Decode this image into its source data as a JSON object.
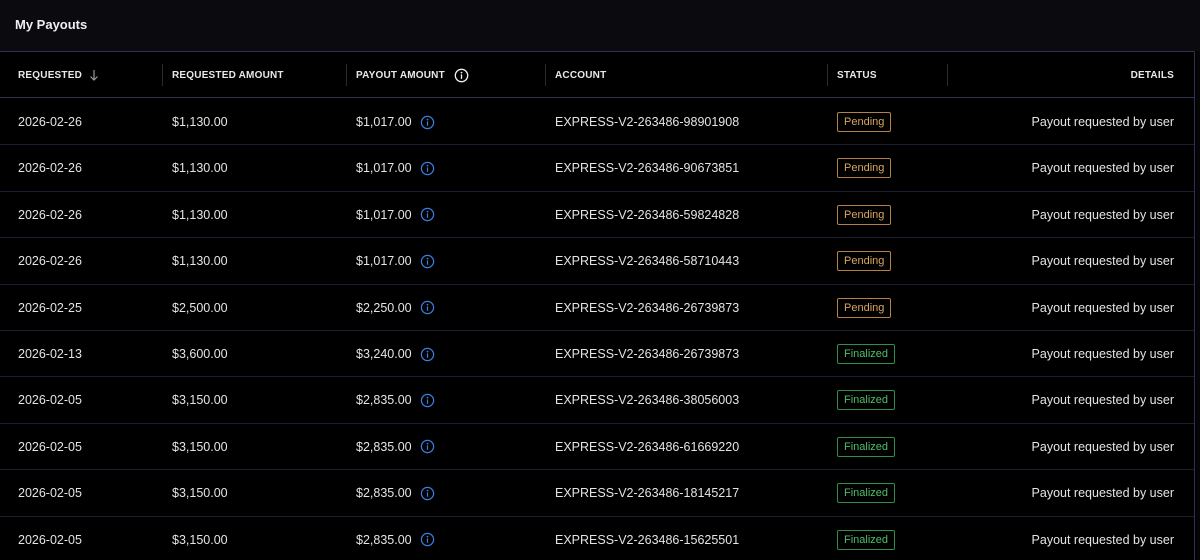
{
  "page": {
    "title": "My Payouts"
  },
  "table": {
    "columns": {
      "requested": "REQUESTED",
      "requested_amount": "REQUESTED AMOUNT",
      "payout_amount": "PAYOUT AMOUNT",
      "account": "ACCOUNT",
      "status": "STATUS",
      "details": "DETAILS"
    },
    "sort": {
      "column": "requested",
      "direction": "descending"
    },
    "rows": [
      {
        "requested": "2026-02-26",
        "requested_amount": "$1,130.00",
        "payout_amount": "$1,017.00",
        "account": "EXPRESS-V2-263486-98901908",
        "status": "Pending",
        "status_type": "pending",
        "details": "Payout requested by user"
      },
      {
        "requested": "2026-02-26",
        "requested_amount": "$1,130.00",
        "payout_amount": "$1,017.00",
        "account": "EXPRESS-V2-263486-90673851",
        "status": "Pending",
        "status_type": "pending",
        "details": "Payout requested by user"
      },
      {
        "requested": "2026-02-26",
        "requested_amount": "$1,130.00",
        "payout_amount": "$1,017.00",
        "account": "EXPRESS-V2-263486-59824828",
        "status": "Pending",
        "status_type": "pending",
        "details": "Payout requested by user"
      },
      {
        "requested": "2026-02-26",
        "requested_amount": "$1,130.00",
        "payout_amount": "$1,017.00",
        "account": "EXPRESS-V2-263486-58710443",
        "status": "Pending",
        "status_type": "pending",
        "details": "Payout requested by user"
      },
      {
        "requested": "2026-02-25",
        "requested_amount": "$2,500.00",
        "payout_amount": "$2,250.00",
        "account": "EXPRESS-V2-263486-26739873",
        "status": "Pending",
        "status_type": "pending",
        "details": "Payout requested by user"
      },
      {
        "requested": "2026-02-13",
        "requested_amount": "$3,600.00",
        "payout_amount": "$3,240.00",
        "account": "EXPRESS-V2-263486-26739873",
        "status": "Finalized",
        "status_type": "finalized",
        "details": "Payout requested by user"
      },
      {
        "requested": "2026-02-05",
        "requested_amount": "$3,150.00",
        "payout_amount": "$2,835.00",
        "account": "EXPRESS-V2-263486-38056003",
        "status": "Finalized",
        "status_type": "finalized",
        "details": "Payout requested by user"
      },
      {
        "requested": "2026-02-05",
        "requested_amount": "$3,150.00",
        "payout_amount": "$2,835.00",
        "account": "EXPRESS-V2-263486-61669220",
        "status": "Finalized",
        "status_type": "finalized",
        "details": "Payout requested by user"
      },
      {
        "requested": "2026-02-05",
        "requested_amount": "$3,150.00",
        "payout_amount": "$2,835.00",
        "account": "EXPRESS-V2-263486-18145217",
        "status": "Finalized",
        "status_type": "finalized",
        "details": "Payout requested by user"
      },
      {
        "requested": "2026-02-05",
        "requested_amount": "$3,150.00",
        "payout_amount": "$2,835.00",
        "account": "EXPRESS-V2-263486-15625501",
        "status": "Finalized",
        "status_type": "finalized",
        "details": "Payout requested by user"
      }
    ]
  },
  "colors": {
    "background": "#000000",
    "header_bar": "#0b0b0f",
    "border_accent": "#2e3450",
    "pending": "#d9a55f",
    "finalized": "#4fbf6a",
    "info_icon": "#3d7fe0"
  },
  "icons": {
    "sort": "arrow-down-icon",
    "header_info": "info-circle-icon",
    "row_info": "info-circle-icon"
  }
}
